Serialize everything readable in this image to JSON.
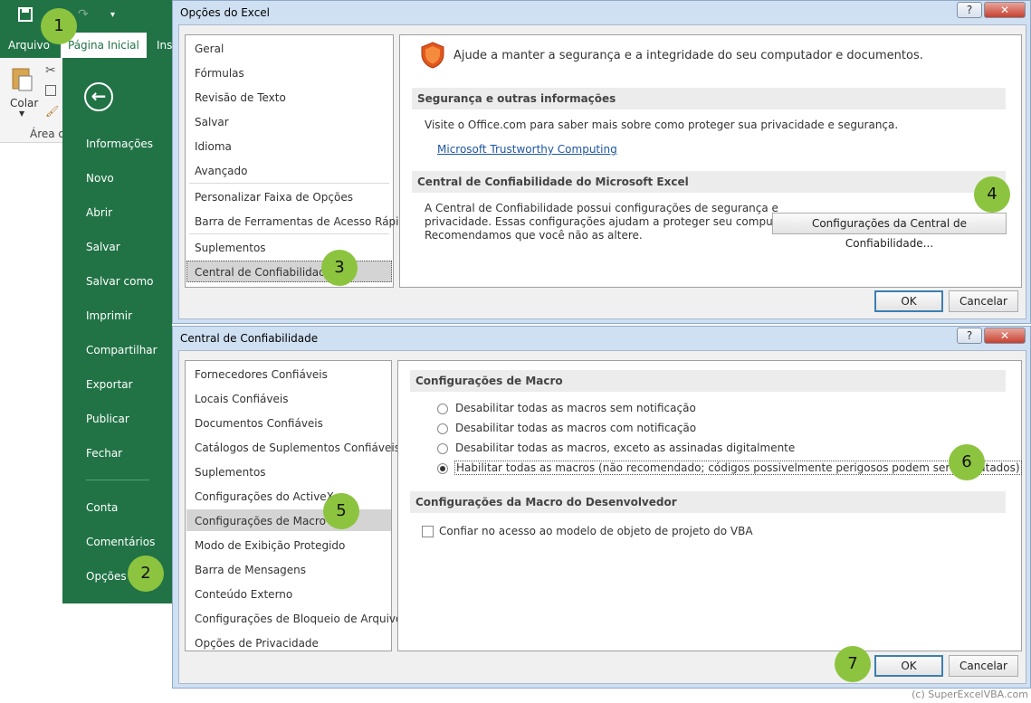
{
  "excel": {
    "tabs": [
      "Arquivo",
      "Página Inicial",
      "Ins"
    ],
    "ribbon": {
      "paste_label": "Colar",
      "group_label": "Área de"
    },
    "backstage_items": [
      "Informações",
      "Novo",
      "Abrir",
      "Salvar",
      "Salvar como",
      "Imprimir",
      "Compartilhar",
      "Exportar",
      "Publicar",
      "Fechar"
    ],
    "backstage_bottom": [
      "Conta",
      "Comentários",
      "Opções"
    ]
  },
  "options_dialog": {
    "title": "Opções do Excel",
    "help": "?",
    "close": "✕",
    "nav_group1": [
      "Geral",
      "Fórmulas",
      "Revisão de Texto",
      "Salvar",
      "Idioma",
      "Avançado"
    ],
    "nav_group2": [
      "Personalizar Faixa de Opções",
      "Barra de Ferramentas de Acesso Rápido"
    ],
    "nav_group3": [
      "Suplementos",
      "Central de Confiabilidade"
    ],
    "header_text": "Ajude a manter a segurança e a integridade do seu computador e documentos.",
    "section1_title": "Segurança e outras informações",
    "section1_text": "Visite o Office.com para saber mais sobre como proteger sua privacidade e segurança.",
    "section1_link": "Microsoft Trustworthy Computing",
    "section2_title": "Central de Confiabilidade do Microsoft Excel",
    "section2_lines": [
      "A Central de Confiabilidade possui configurações de segurança e",
      "privacidade. Essas configurações ajudam a proteger seu computador.",
      "Recomendamos que você não as altere."
    ],
    "trust_button": "Configurações da Central de Confiabilidade...",
    "ok": "OK",
    "cancel": "Cancelar"
  },
  "trust_dialog": {
    "title": "Central de Confiabilidade",
    "help": "?",
    "close": "✕",
    "nav_items": [
      "Fornecedores Confiáveis",
      "Locais Confiáveis",
      "Documentos Confiáveis",
      "Catálogos de Suplementos Confiáveis",
      "Suplementos",
      "Configurações do ActiveX",
      "Configurações de Macro",
      "Modo de Exibição Protegido",
      "Barra de Mensagens",
      "Conteúdo Externo",
      "Configurações de Bloqueio de Arquivo",
      "Opções de Privacidade"
    ],
    "macro_section": "Configurações de Macro",
    "macro_options": [
      "Desabilitar todas as macros sem notificação",
      "Desabilitar todas as macros com notificação",
      "Desabilitar todas as macros, exceto as assinadas digitalmente",
      "Habilitar todas as macros (não recomendado; códigos possivelmente perigosos podem ser executados)"
    ],
    "dev_section": "Configurações da Macro do Desenvolvedor",
    "vba_checkbox": "Confiar no acesso ao modelo de objeto de projeto do VBA",
    "ok": "OK",
    "cancel": "Cancelar"
  },
  "badges": [
    "1",
    "2",
    "3",
    "4",
    "5",
    "6",
    "7"
  ],
  "copyright": "(c) SuperExcelVBA.com"
}
